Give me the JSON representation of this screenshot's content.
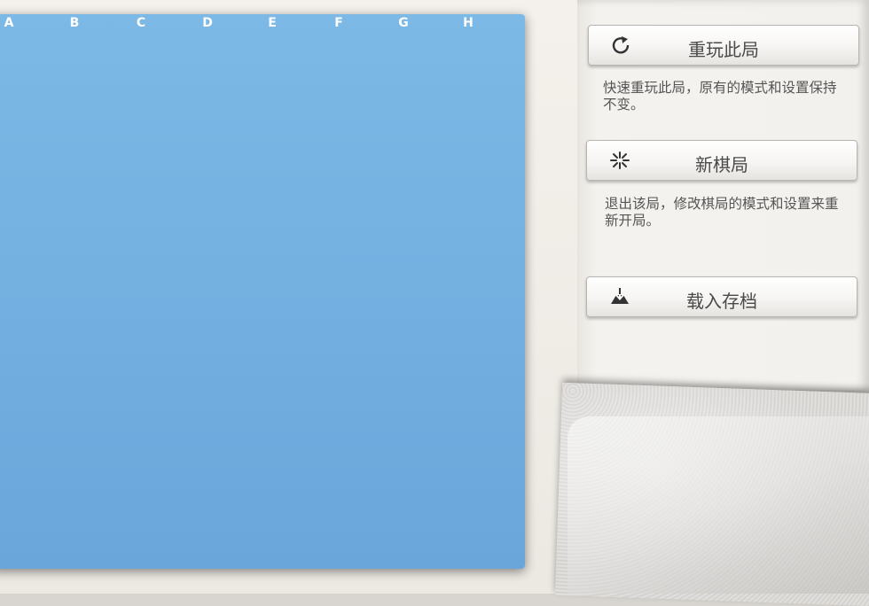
{
  "board": {
    "color": "#72aee0",
    "columns": [
      "A",
      "B",
      "C",
      "D",
      "E",
      "F",
      "G",
      "H"
    ]
  },
  "panel": {
    "replay": {
      "label": "重玩此局",
      "icon": "replay-icon",
      "description": "快速重玩此局，原有的模式和设置保持不变。"
    },
    "new_game": {
      "label": "新棋局",
      "icon": "sparkle-icon",
      "description": "退出该局，修改棋局的模式和设置来重新开局。"
    },
    "load": {
      "label": "载入存档",
      "icon": "load-save-icon"
    }
  }
}
